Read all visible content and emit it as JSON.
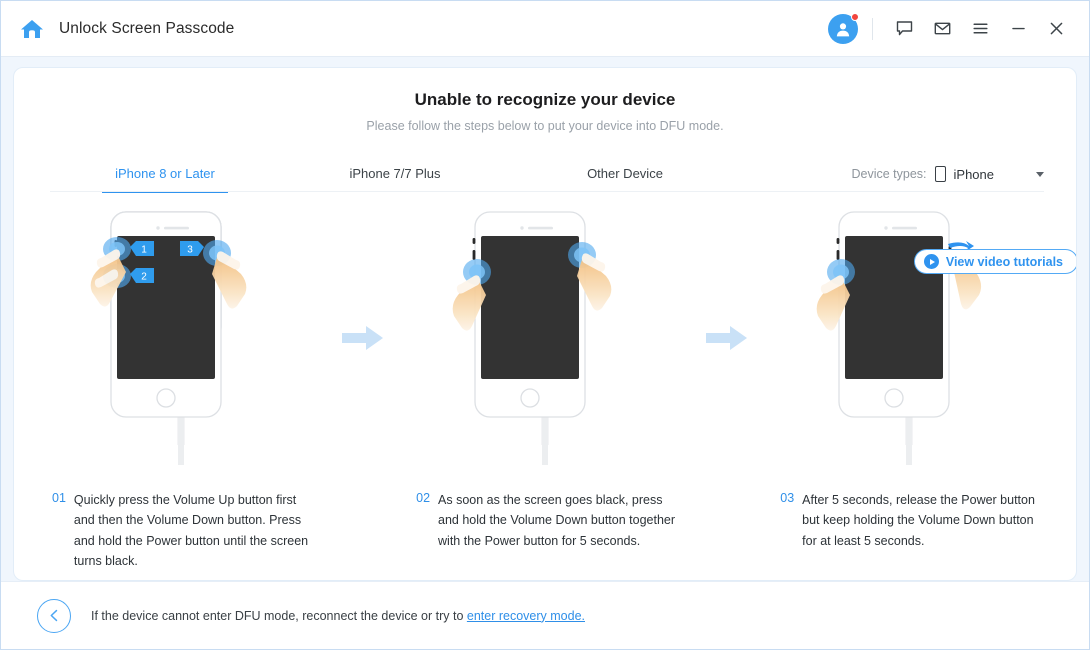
{
  "titlebar": {
    "home_icon": "home-icon",
    "title": "Unlock Screen Passcode",
    "avatar_icon": "user-avatar-icon",
    "feedback_icon": "speech-bubble-icon",
    "mail_icon": "envelope-icon",
    "menu_icon": "hamburger-menu-icon",
    "minimize_icon": "minimize-icon",
    "close_icon": "close-icon"
  },
  "main": {
    "headline": "Unable to recognize your device",
    "subhead": "Please follow the steps below to put your device into DFU mode.",
    "tabs": [
      {
        "label": "iPhone 8 or Later",
        "active": true
      },
      {
        "label": "iPhone 7/7 Plus",
        "active": false
      },
      {
        "label": "Other Device",
        "active": false
      }
    ],
    "device_types": {
      "label": "Device types:",
      "icon": "phone-icon",
      "value": "iPhone",
      "caret": "chevron-down-icon"
    },
    "video_button": {
      "label": "View video tutorials",
      "icon": "play-circle-icon"
    },
    "steps": [
      {
        "number": "01",
        "text": "Quickly press the Volume Up button first and then the Volume Down button. Press and hold the Power button until the screen turns black.",
        "badges": [
          "1",
          "2",
          "3"
        ]
      },
      {
        "number": "02",
        "text": "As soon as the screen goes black, press and hold the Volume Down button together with the Power button for 5 seconds.",
        "badges": []
      },
      {
        "number": "03",
        "text": "After 5 seconds, release the Power button but keep holding the Volume Down button for at least 5 seconds.",
        "badges": []
      }
    ]
  },
  "footer": {
    "back_icon": "back-arrow-icon",
    "text_before": "If the device cannot enter DFU mode, reconnect the device or try to ",
    "link": "enter recovery mode."
  },
  "colors": {
    "accent": "#2f93ef",
    "page_bg": "#f0f6fd",
    "screen": "#333333",
    "hand": "#f6c98a",
    "badge": "#2f9ced"
  }
}
